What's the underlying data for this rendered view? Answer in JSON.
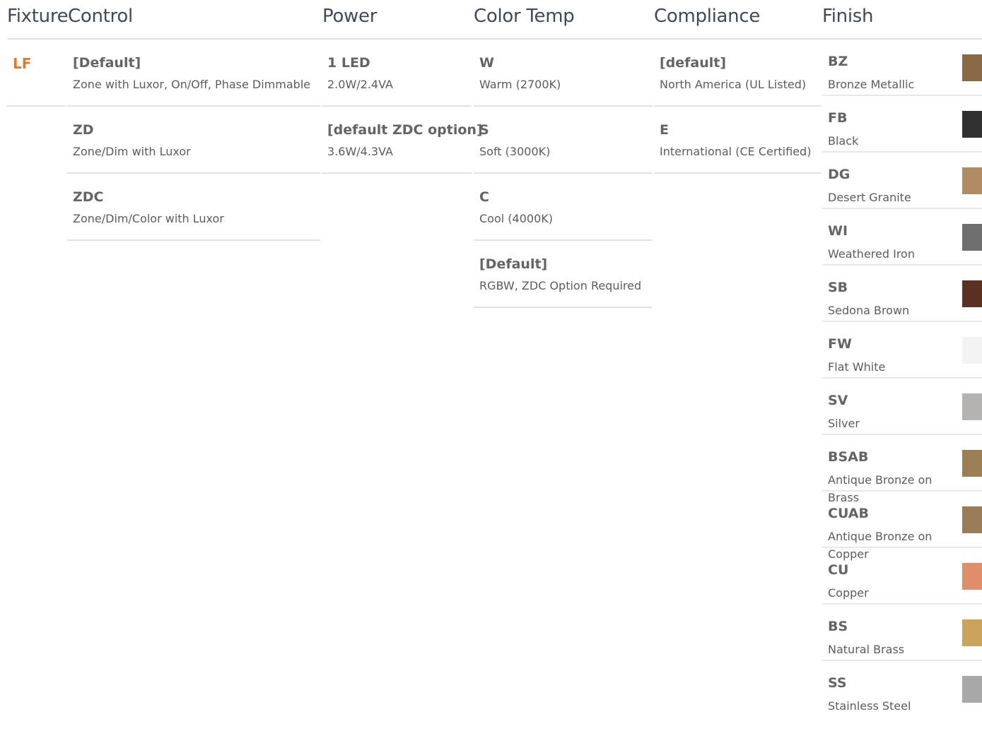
{
  "headers": {
    "fixture": "Fixture",
    "control": "Control",
    "power": "Power",
    "color_temp": "Color Temp",
    "compliance": "Compliance",
    "finish": "Finish"
  },
  "fixture": {
    "code": "LF"
  },
  "control": [
    {
      "code": "[Default]",
      "desc": "Zone with Luxor, On/Off, Phase Dimmable"
    },
    {
      "code": "ZD",
      "desc": "Zone/Dim with Luxor"
    },
    {
      "code": "ZDC",
      "desc": "Zone/Dim/Color with Luxor"
    }
  ],
  "power": [
    {
      "code": "1 LED",
      "desc": "2.0W/2.4VA"
    },
    {
      "code": "[default ZDC option]",
      "desc": "3.6W/4.3VA"
    }
  ],
  "color_temp": [
    {
      "code": "W",
      "desc": "Warm (2700K)"
    },
    {
      "code": "S",
      "desc": "Soft (3000K)"
    },
    {
      "code": "C",
      "desc": "Cool (4000K)"
    },
    {
      "code": "[Default]",
      "desc": "RGBW, ZDC Option Required"
    }
  ],
  "compliance": [
    {
      "code": "[default]",
      "desc": "North America (UL Listed)"
    },
    {
      "code": "E",
      "desc": "International (CE Certified)"
    }
  ],
  "finish": [
    {
      "code": "BZ",
      "desc": "Bronze Metallic",
      "color": "#8a6a45"
    },
    {
      "code": "FB",
      "desc": "Black",
      "color": "#323131"
    },
    {
      "code": "DG",
      "desc": "Desert Granite",
      "color": "#b08a62"
    },
    {
      "code": "WI",
      "desc": "Weathered Iron",
      "color": "#6e6e6e"
    },
    {
      "code": "SB",
      "desc": "Sedona Brown",
      "color": "#5a3020"
    },
    {
      "code": "FW",
      "desc": "Flat White",
      "color": "#f3f3f3"
    },
    {
      "code": "SV",
      "desc": "Silver",
      "color": "#b5b3b0"
    },
    {
      "code": "BSAB",
      "desc": "Antique Bronze on Brass",
      "color": "#9c7e55"
    },
    {
      "code": "CUAB",
      "desc": "Antique Bronze on Copper",
      "color": "#9a7c56"
    },
    {
      "code": "CU",
      "desc": "Copper",
      "color": "#e08d6a"
    },
    {
      "code": "BS",
      "desc": "Natural Brass",
      "color": "#c9a45a"
    },
    {
      "code": "SS",
      "desc": "Stainless Steel",
      "color": "#a8a8a8"
    }
  ]
}
